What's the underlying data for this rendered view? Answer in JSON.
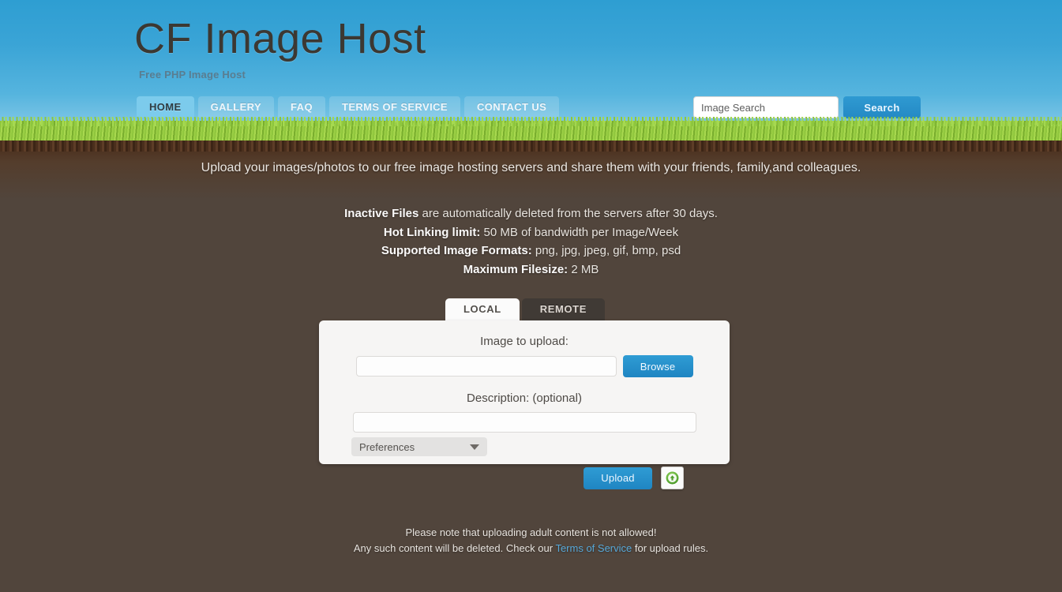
{
  "header": {
    "title": "CF Image Host",
    "subtitle": "Free PHP Image Host"
  },
  "nav": {
    "items": [
      {
        "label": "HOME",
        "active": true
      },
      {
        "label": "GALLERY",
        "active": false
      },
      {
        "label": "FAQ",
        "active": false
      },
      {
        "label": "TERMS OF SERVICE",
        "active": false
      },
      {
        "label": "CONTACT US",
        "active": false
      }
    ]
  },
  "search": {
    "placeholder": "Image Search",
    "value": "",
    "button_label": "Search"
  },
  "main": {
    "lead": "Upload your images/photos to our free image hosting servers and share them with your friends, family,and colleagues.",
    "info": [
      {
        "bold": "Inactive Files",
        "rest": " are automatically deleted from the servers after 30 days."
      },
      {
        "bold": "Hot Linking limit:",
        "rest": " 50 MB of bandwidth per Image/Week"
      },
      {
        "bold": "Supported Image Formats:",
        "rest": " png, jpg, jpeg, gif, bmp, psd"
      },
      {
        "bold": "Maximum Filesize:",
        "rest": " 2 MB"
      }
    ]
  },
  "upload": {
    "tabs": [
      {
        "label": "LOCAL",
        "active": true
      },
      {
        "label": "REMOTE",
        "active": false
      }
    ],
    "image_label": "Image to upload:",
    "file_value": "",
    "browse_label": "Browse",
    "description_label": "Description: (optional)",
    "description_value": "",
    "preferences_label": "Preferences",
    "upload_label": "Upload",
    "add_icon": "add-circle-icon"
  },
  "footer": {
    "line1": "Please note that uploading adult content is not allowed!",
    "line2_before": "Any such content will be deleted. Check our ",
    "link": "Terms of Service",
    "line2_after": " for upload rules."
  },
  "colors": {
    "sky_top": "#2e9ed2",
    "sky_bottom": "#7ec6e6",
    "grass": "#8fc63d",
    "dirt": "#51453c",
    "accent_blue": "#2489c4",
    "link_blue": "#57a8d8",
    "green_icon": "#5aa832"
  }
}
